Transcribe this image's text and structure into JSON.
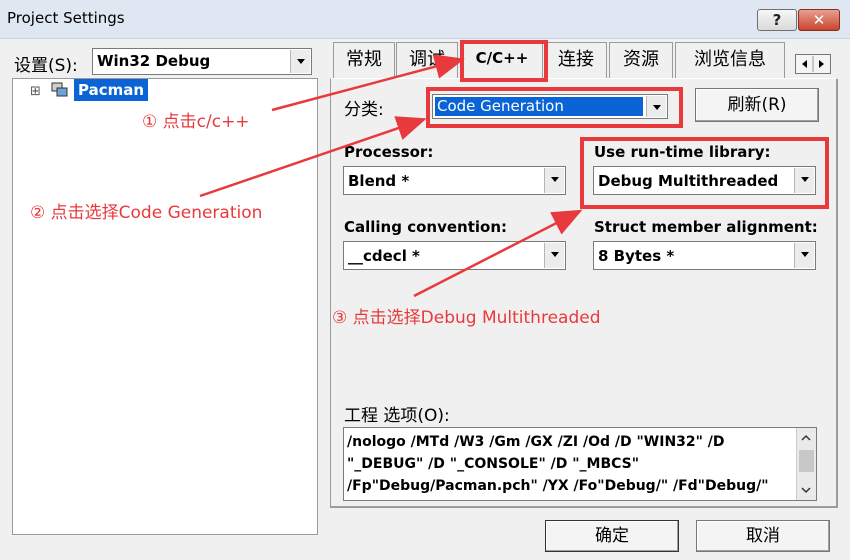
{
  "window": {
    "title": "Project Settings",
    "help_glyph": "?",
    "close_glyph": "✕"
  },
  "left": {
    "settings_label": "设置(S):",
    "config_value": "Win32 Debug",
    "tree_expand": "⊞",
    "tree_item": "Pacman"
  },
  "tabs": [
    {
      "label": "常规"
    },
    {
      "label": "调试"
    },
    {
      "label": "C/C++"
    },
    {
      "label": "连接"
    },
    {
      "label": "资源"
    },
    {
      "label": "浏览信息"
    }
  ],
  "category": {
    "label": "分类:",
    "value": "Code Generation",
    "reset_label": "刷新(R)"
  },
  "processor": {
    "label": "Processor:",
    "value": "Blend *"
  },
  "runtime": {
    "label": "Use run-time library:",
    "value": "Debug Multithreaded"
  },
  "calling": {
    "label": "Calling convention:",
    "value": "__cdecl *"
  },
  "struct_align": {
    "label": "Struct member alignment:",
    "value": "8 Bytes *"
  },
  "options": {
    "label": "工程 选项(O):",
    "lines": [
      "/nologo /MTd /W3 /Gm /GX /ZI /Od /D \"WIN32\" /D",
      "\"_DEBUG\" /D \"_CONSOLE\" /D \"_MBCS\"",
      "/Fp\"Debug/Pacman.pch\" /YX /Fo\"Debug/\" /Fd\"Debug/\""
    ]
  },
  "buttons": {
    "ok": "确定",
    "cancel": "取消"
  },
  "annotations": {
    "step1": "① 点击c/c++",
    "step2": "② 点击选择Code Generation",
    "step3": "③ 点击选择Debug Multithreaded",
    "color": "#e8393c"
  }
}
